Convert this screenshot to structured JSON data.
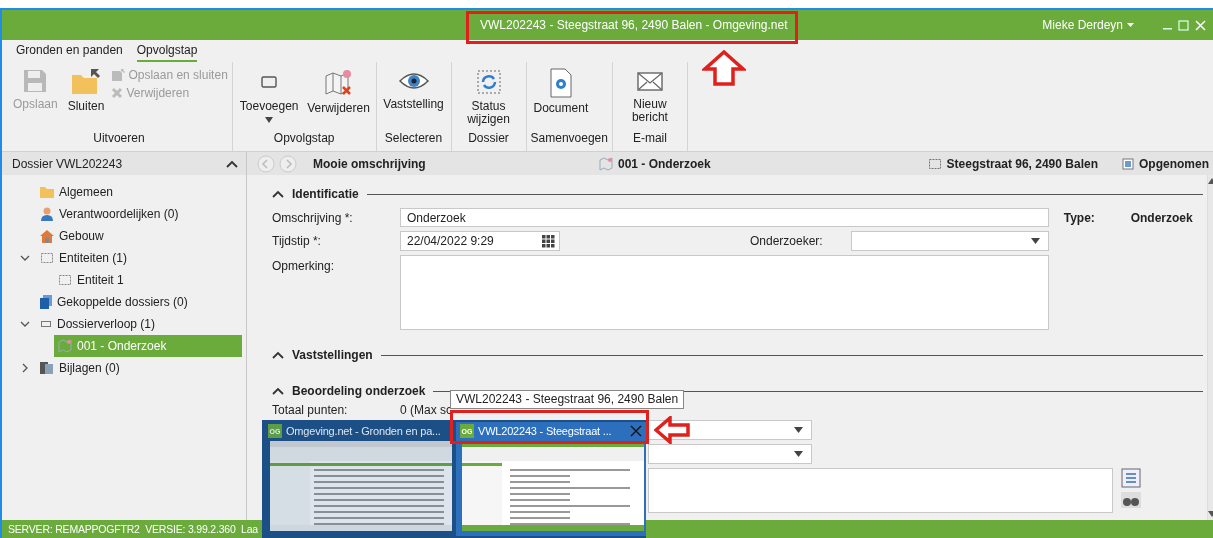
{
  "window": {
    "title": "VWL202243 - Steegstraat 96, 2490 Balen - Omgeving.net",
    "user": "Mieke Derdeyn"
  },
  "ribbon": {
    "tabs": [
      {
        "label": "Gronden en panden",
        "selected": false
      },
      {
        "label": "Opvolgstap",
        "selected": true
      }
    ],
    "groups": [
      {
        "label": "Uitvoeren",
        "buttons": [
          {
            "kind": "large",
            "label": "Opslaan",
            "disabled": true
          },
          {
            "kind": "large",
            "label": "Sluiten",
            "disabled": false
          },
          {
            "kind": "small",
            "label": "Opslaan en sluiten",
            "disabled": true
          },
          {
            "kind": "small",
            "label": "Verwijderen",
            "disabled": true
          }
        ]
      },
      {
        "label": "Opvolgstap",
        "buttons": [
          {
            "kind": "menu",
            "label": "Toevoegen",
            "disabled": false
          },
          {
            "kind": "large",
            "label": "Verwijderen",
            "disabled": false
          }
        ]
      },
      {
        "label": "Selecteren",
        "buttons": [
          {
            "kind": "large",
            "label": "Vaststelling",
            "disabled": false
          }
        ]
      },
      {
        "label": "Dossier",
        "buttons": [
          {
            "kind": "large",
            "label": "Status wijzigen",
            "disabled": false
          }
        ]
      },
      {
        "label": "Samenvoegen",
        "buttons": [
          {
            "kind": "large",
            "label": "Document",
            "disabled": false
          }
        ]
      },
      {
        "label": "E-mail",
        "buttons": [
          {
            "kind": "large",
            "label": "Nieuw bericht",
            "disabled": false
          }
        ]
      }
    ]
  },
  "sidebar": {
    "title": "Dossier VWL202243",
    "items": [
      {
        "label": "Algemeen",
        "selected": false
      },
      {
        "label": "Verantwoordelijken (0)",
        "selected": false
      },
      {
        "label": "Gebouw",
        "selected": false
      },
      {
        "label": "Entiteiten (1)",
        "selected": false,
        "expanded": true,
        "children": [
          {
            "label": "Entiteit 1",
            "selected": false
          }
        ]
      },
      {
        "label": "Gekoppelde dossiers (0)",
        "selected": false
      },
      {
        "label": "Dossierverloop (1)",
        "selected": false,
        "expanded": true,
        "children": [
          {
            "label": "001 - Onderzoek",
            "selected": true
          }
        ]
      },
      {
        "label": "Bijlagen (0)",
        "selected": false,
        "expanded": false
      }
    ]
  },
  "header": {
    "title": "Mooie omschrijving",
    "step": "001 - Onderzoek",
    "address": "Steegstraat 96, 2490 Balen",
    "status": "Opgenomen"
  },
  "sections": [
    {
      "title": "Identificatie",
      "expanded": true
    },
    {
      "title": "Vaststellingen",
      "expanded": true
    },
    {
      "title": "Beoordeling onderzoek",
      "expanded": true
    }
  ],
  "identificatie": {
    "omschrijving_label": "Omschrijving *:",
    "omschrijving": "Onderzoek",
    "tijdstip_label": "Tijdstip *:",
    "tijdstip": "22/04/2022 9:29",
    "onderzoeker_label": "Onderzoeker:",
    "opmerking_label": "Opmerking:",
    "type_label": "Type:",
    "type": "Onderzoek"
  },
  "beoordeling": {
    "totaal_label": "Totaal punten:",
    "totaal": "0 (Max sc"
  },
  "taskbar_preview": {
    "tooltip": "VWL202243 - Steegstraat 96, 2490 Balen",
    "windows": [
      {
        "badge": "OG",
        "title": "Omgeving.net - Gronden en pa...",
        "selected": false
      },
      {
        "badge": "OG",
        "title": "VWL202243 - Steegstraat ...",
        "selected": true
      }
    ]
  },
  "status_bar": "SERVER: REMAPPOGFTR2  VERSIE: 3.99.2.360  Laa"
}
